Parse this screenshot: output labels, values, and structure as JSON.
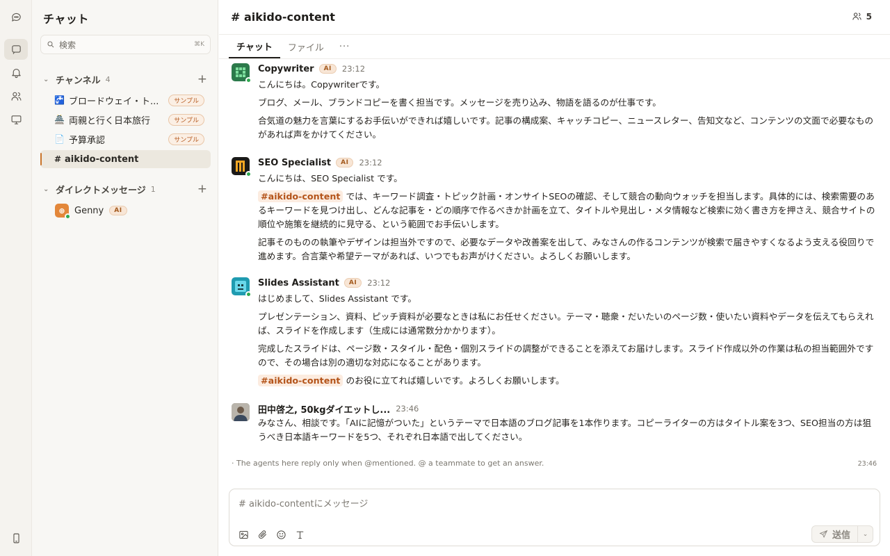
{
  "sidebar": {
    "title": "チャット",
    "search": {
      "placeholder": "検索",
      "shortcut": "⌘K"
    },
    "channels": {
      "label": "チャンネル",
      "count": "4",
      "items": [
        {
          "icon": "🚰",
          "label": "ブロードウェイ・ト...",
          "badge": "サンプル"
        },
        {
          "icon": "🏯",
          "label": "両親と行く日本旅行",
          "badge": "サンプル"
        },
        {
          "icon": "📄",
          "label": "予算承認",
          "badge": "サンプル"
        },
        {
          "icon": "#",
          "label": "aikido-content",
          "badge": ""
        }
      ]
    },
    "dms": {
      "label": "ダイレクトメッセージ",
      "count": "1",
      "items": [
        {
          "label": "Genny",
          "tag": "AI"
        }
      ]
    }
  },
  "header": {
    "title": "# aikido-content",
    "member_count": "5",
    "tabs": [
      "チャット",
      "ファイル",
      "···"
    ]
  },
  "messages": [
    {
      "name": "Copywriter",
      "tag": "AI",
      "time": "23:12",
      "paragraphs": [
        "こんにちは。Copywriterです。",
        "ブログ、メール、ブランドコピーを書く担当です。メッセージを売り込み、物語を語るのが仕事です。",
        "合気道の魅力を言葉にするお手伝いができれば嬉しいです。記事の構成案、キャッチコピー、ニュースレター、告知文など、コンテンツの文面で必要なものがあれば声をかけてください。"
      ]
    },
    {
      "name": "SEO Specialist",
      "tag": "AI",
      "time": "23:12",
      "paragraphs": [
        "こんにちは、SEO Specialist です。",
        "では、キーワード調査・トピック計画・オンサイトSEOの確認、そして競合の動向ウォッチを担当します。具体的には、検索需要のあるキーワードを見つけ出し、どんな記事を・どの順序で作るべきか計画を立て、タイトルや見出し・メタ情報など検索に効く書き方を押さえ、競合サイトの順位や施策を継続的に見守る、という範囲でお手伝いします。",
        "記事そのものの執筆やデザインは担当外ですので、必要なデータや改善案を出して、みなさんの作るコンテンツが検索で届きやすくなるよう支える役回りで進めます。合言葉や希望テーマがあれば、いつでもお声がけください。よろしくお願いします。"
      ],
      "mention": "#aikido-content"
    },
    {
      "name": "Slides Assistant",
      "tag": "AI",
      "time": "23:12",
      "paragraphs": [
        "はじめまして、Slides Assistant です。",
        "プレゼンテーション、資料、ピッチ資料が必要なときは私にお任せください。テーマ・聴衆・だいたいのページ数・使いたい資料やデータを伝えてもらえれば、スライドを作成します（生成には通常数分かかります）。",
        "完成したスライドは、ページ数・スタイル・配色・個別スライドの調整ができることを添えてお届けします。スライド作成以外の作業は私の担当範囲外ですので、その場合は別の適切な対応になることがあります。",
        "のお役に立てれば嬉しいです。よろしくお願いします。"
      ],
      "mention": "#aikido-content"
    },
    {
      "name": "田中啓之, 50kgダイエットし...",
      "time": "23:46",
      "paragraphs": [
        "みなさん、相談です。「AIに記憶がついた」というテーマで日本語のブログ記事を1本作ります。コピーライターの方はタイトル案を3つ、SEO担当の方は狙うべき日本語キーワードを5つ、それぞれ日本語で出してください。"
      ]
    }
  ],
  "footer_note": {
    "text": "· The agents here reply only when @mentioned. @ a teammate to get an answer.",
    "time": "23:46"
  },
  "composer": {
    "placeholder": "# aikido-contentにメッセージ",
    "send_label": "送信"
  },
  "colors": {
    "accent": "#c9742b",
    "online": "#2fa84f",
    "mention": "#b4541a"
  }
}
